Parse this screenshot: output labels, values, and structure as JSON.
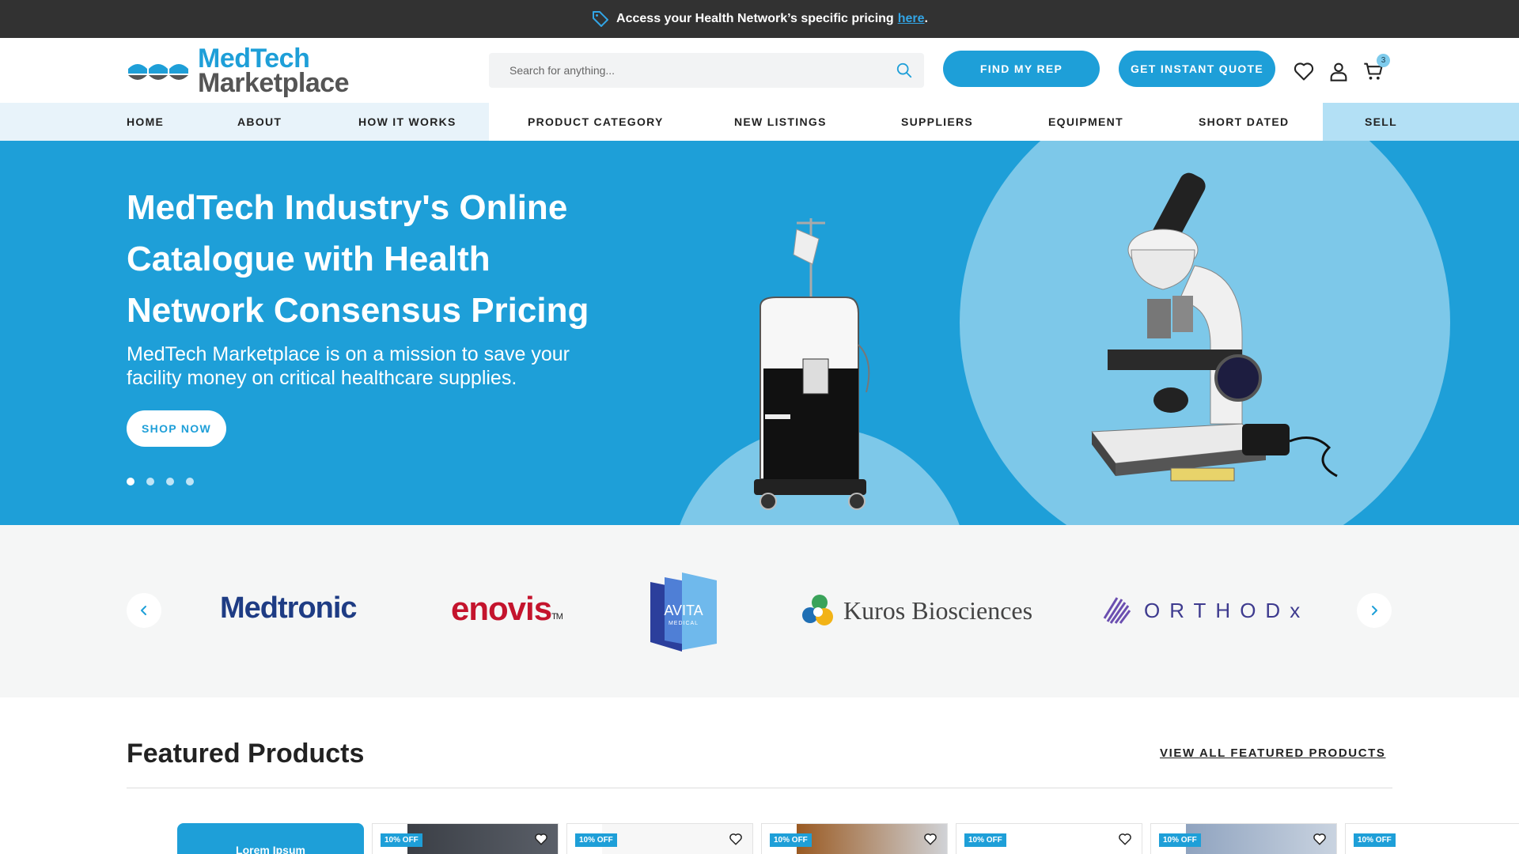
{
  "topbar": {
    "text": "Access your Health Network’s specific pricing",
    "link_label": "here",
    "trailing": ".",
    "icon": "tag-icon"
  },
  "header": {
    "logo_line1": "MedTech",
    "logo_line2": "Marketplace",
    "search_placeholder": "Search for anything...",
    "find_rep_label": "FIND MY REP",
    "quote_label": "GET INSTANT QUOTE",
    "cart_count": "3",
    "icons": [
      "search-icon",
      "heart-icon",
      "user-icon",
      "cart-icon"
    ]
  },
  "nav": {
    "items": [
      "HOME",
      "ABOUT",
      "HOW IT WORKS",
      "PRODUCT CATEGORY",
      "NEW LISTINGS",
      "SUPPLIERS",
      "EQUIPMENT",
      "SHORT DATED",
      "SELL"
    ]
  },
  "hero": {
    "title": "MedTech Industry's Online Catalogue with Health Network Consensus Pricing",
    "subtitle": "MedTech Marketplace is on a mission to save your facility money on critical healthcare supplies.",
    "cta_label": "SHOP NOW",
    "slide_count": 4,
    "active_slide": 1
  },
  "brands": {
    "items": [
      "Medtronic",
      "enovis",
      "AVITA",
      "MEDICAL",
      "Kuros Biosciences",
      "ORTHODx"
    ],
    "enovis_tm": "TM"
  },
  "featured": {
    "title": "Featured Products",
    "view_all_label": "VIEW ALL FEATURED PRODUCTS",
    "promo_label": "Lorem Ipsum",
    "discount_label": "10% OFF",
    "colors": {
      "accent": "#1e9fd8",
      "dark": "#323232",
      "light_blue": "#7dc8e9"
    }
  }
}
